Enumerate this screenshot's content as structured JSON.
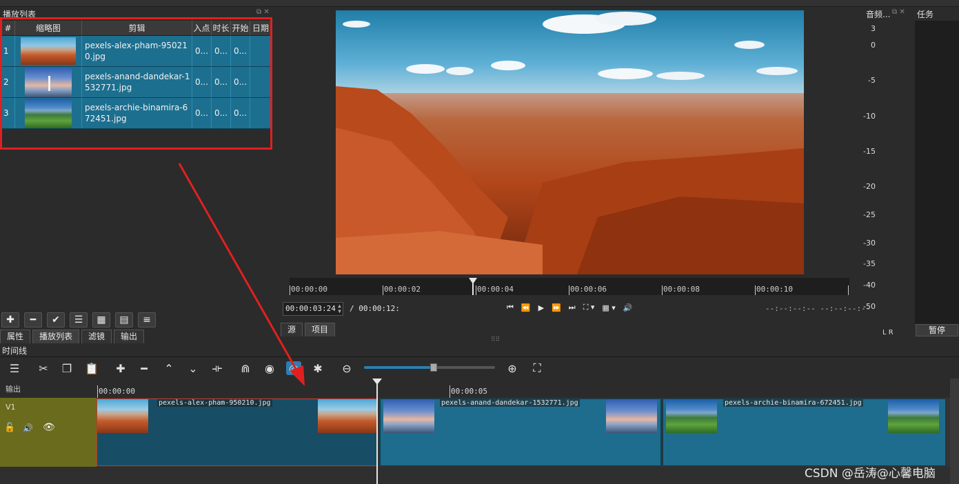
{
  "playlist": {
    "title": "播放列表",
    "columns": [
      "#",
      "缩略图",
      "剪辑",
      "入点",
      "时长",
      "开始",
      "日期"
    ],
    "rows": [
      {
        "num": "1",
        "name": "pexels-alex-pham-950210.jpg",
        "in": "0...",
        "dur": "0...",
        "start": "0...",
        "thumb": "desert-thumbnail"
      },
      {
        "num": "2",
        "name": "pexels-anand-dandekar-1532771.jpg",
        "in": "0...",
        "dur": "0...",
        "start": "0...",
        "thumb": "lighthouse-thumbnail"
      },
      {
        "num": "3",
        "name": "pexels-archie-binamira-672451.jpg",
        "in": "0...",
        "dur": "0...",
        "start": "0...",
        "thumb": "mountain-thumbnail"
      }
    ],
    "tabs": [
      "属性",
      "播放列表",
      "滤镜",
      "输出"
    ]
  },
  "viewer": {
    "ruler_labels": [
      "00:00:00",
      "00:00:02",
      "00:00:04",
      "00:00:06",
      "00:00:08",
      "00:00:10"
    ],
    "timecode": "00:00:03:24",
    "duration": "/ 00:00:12:",
    "in_out": "--:--:--:-- --:--:--:--",
    "tabs": [
      "源",
      "项目"
    ]
  },
  "audio": {
    "title": "音频...",
    "scale": [
      "3",
      "0",
      "-5",
      "-10",
      "-15",
      "-20",
      "-25",
      "-30",
      "-35",
      "-40",
      "-50"
    ],
    "channels": "L  R"
  },
  "tasks": {
    "title": "任务",
    "pause_label": "暂停"
  },
  "timeline": {
    "title": "时间线",
    "output_label": "输出",
    "track_label": "V1",
    "ruler_labels": [
      "00:00:00",
      "00:00:05"
    ],
    "clips": [
      {
        "name": "pexels-alex-pham-950210.jpg"
      },
      {
        "name": "pexels-anand-dandekar-1532771.jpg"
      },
      {
        "name": "pexels-archie-binamira-672451.jpg"
      }
    ]
  },
  "watermark": "CSDN @岳涛@心馨电脑",
  "colors": {
    "selection": "#1d6f8f",
    "annotation": "#e02020",
    "track_header": "#6b6b1e",
    "clip": "#1e6d8e"
  }
}
